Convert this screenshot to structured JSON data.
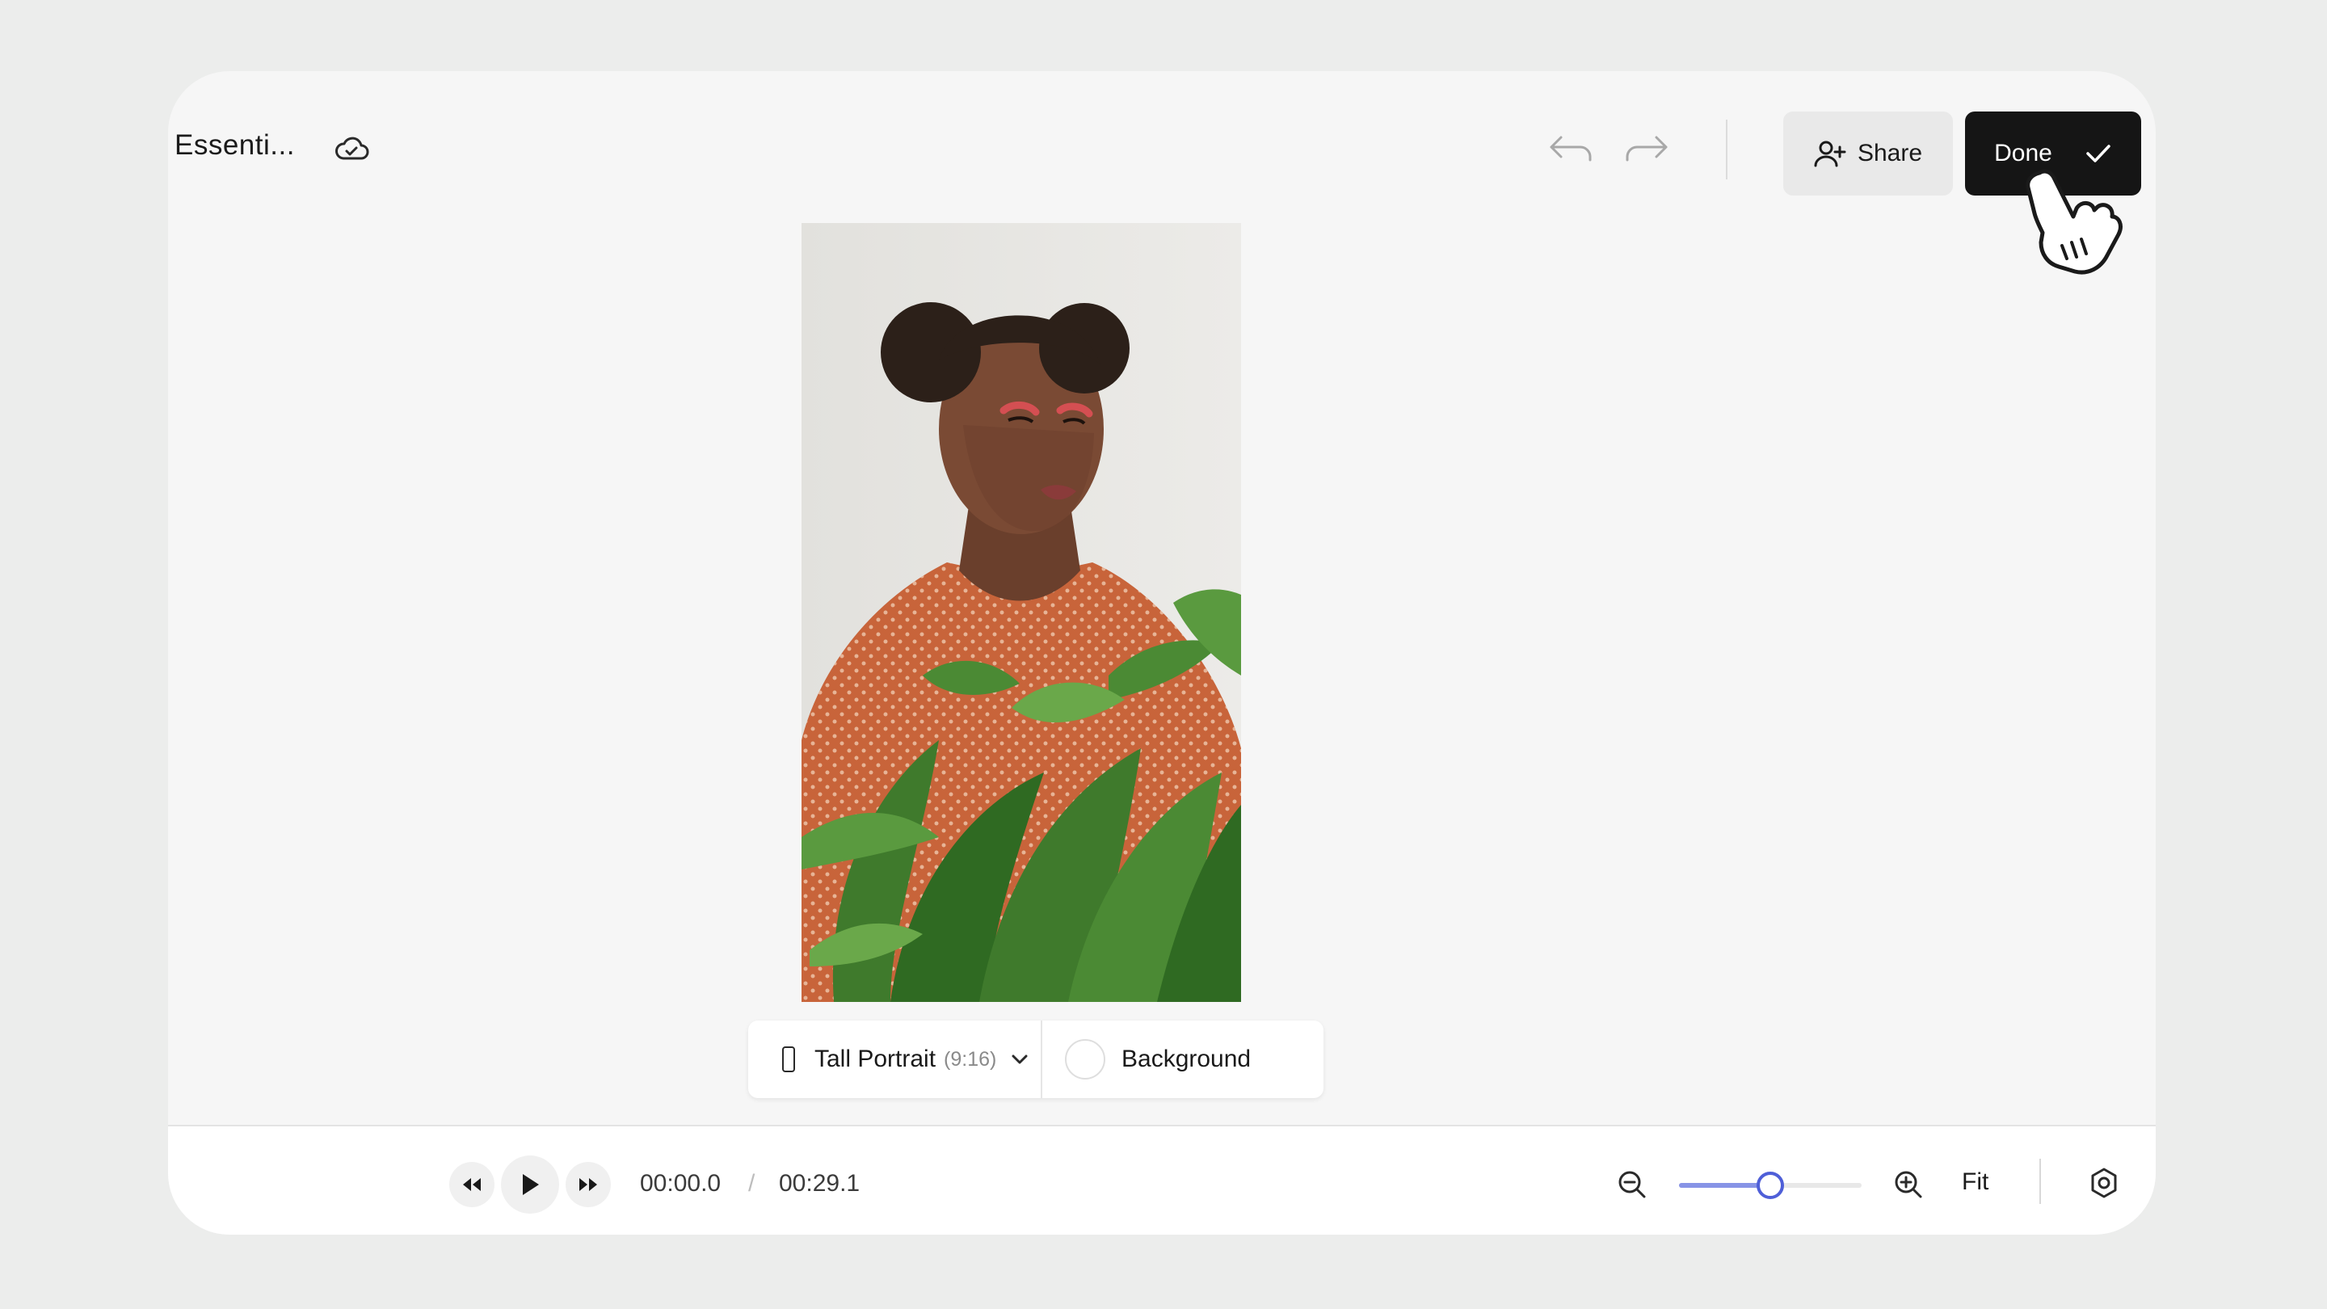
{
  "project": {
    "title": "Essenti..."
  },
  "header": {
    "share_label": "Share",
    "done_label": "Done"
  },
  "format": {
    "aspect_label": "Tall Portrait",
    "aspect_ratio": "(9:16)",
    "background_label": "Background"
  },
  "player": {
    "current_time": "00:00.0",
    "separator": "/",
    "total_time": "00:29.1"
  },
  "zoom": {
    "level_fraction": 0.5,
    "fit_label": "Fit"
  },
  "colors": {
    "accent": "#4f5fd8",
    "done_bg": "#151515",
    "page_bg": "#ecedec",
    "window_bg": "#f6f6f6"
  },
  "icons": [
    "cloud-icon",
    "undo-icon",
    "redo-icon",
    "add-user-icon",
    "check-icon",
    "pointer-hand-icon",
    "portrait-phone-icon",
    "chevron-down-icon",
    "rewind-icon",
    "play-icon",
    "fast-forward-icon",
    "zoom-out-icon",
    "zoom-in-icon",
    "gear-icon"
  ]
}
